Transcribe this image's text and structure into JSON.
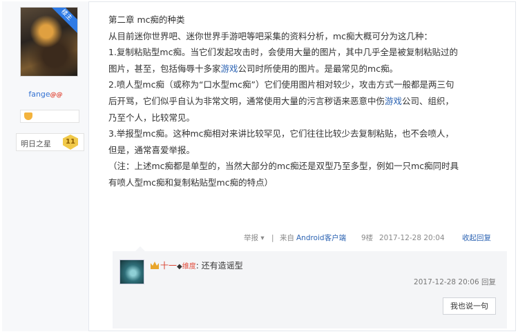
{
  "author": {
    "badge": "楼主",
    "username": "fange",
    "vip_mark": "@@",
    "level_name": "明日之星",
    "level_number": "11"
  },
  "post": {
    "lines": [
      "第二章 mc痴的种类",
      "从目前迷你世界吧、迷你世界手游吧等吧采集的资料分析，mc痴大概可分为这几种：",
      "1.复制粘贴型mc痴。当它们发起攻击时，会使用大量的图片，其中几乎全是被复制粘贴过的",
      "图片，甚至，包括侮辱十多家{link}公司时所使用的图片。是最常见的mc痴。",
      "2.喷人型mc痴（或称为“口水型mc痴”）它们使用图片相对较少，攻击方式一般都是两三句",
      "后开骂，它们似乎自认为非常文明，通常使用大量的污言秽语来恶意中伤{link}公司、组织，",
      "乃至个人，比较常见。",
      "3.举报型mc痴。这种mc痴相对来讲比较罕见，它们往往比较少去复制粘贴，也不会喷人，",
      "但是，通常喜爱举报。",
      "（注：上述mc痴都是单型的，当然大部分的mc痴还是双型乃至多型，例如一只mc痴同时具",
      "有喷人型mc痴和复制粘贴型mc痴的特点）"
    ],
    "line3_before": "图片，甚至，包括侮辱十多家",
    "line3_link": "游戏",
    "line3_after": "公司时所使用的图片。是最常见的mc痴。",
    "line5_before": "后开骂，它们似乎自认为非常文明，通常使用大量的污言秽语来恶意中伤",
    "line5_link": "游戏",
    "line5_after": "公司、组织，"
  },
  "meta": {
    "report_label": "举报",
    "report_arrow": "▾",
    "divider": "|",
    "source_prefix": "来自",
    "source_client": "Android客户端",
    "floor": "9楼",
    "datetime": "2017-12-28 20:04",
    "collapse_reply": "收起回复"
  },
  "reply": {
    "username": "十一",
    "diamond": "◆",
    "vip_label": "维度",
    "separator": ":",
    "text": "还有造谣型",
    "datetime": "2017-12-28 20:06",
    "reply_label": "回复",
    "say_button": "我也说一句"
  }
}
